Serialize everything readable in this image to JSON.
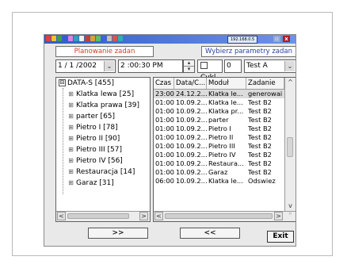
{
  "titlebar": {
    "ip_address": "192.168.0.5",
    "maximize_glyph": "▫",
    "close_glyph": "x",
    "icon_colors": [
      "#e04040",
      "#f0c030",
      "#40a040",
      "#3060d0",
      "#e080e0",
      "#30a0c0",
      "#f0f0f0",
      "#c04040",
      "#e0a030",
      "#60c060",
      "#4060e0",
      "#c0c0c0",
      "#e05050",
      "#30b0b0"
    ]
  },
  "header": {
    "left_label": "Planowanie zadan",
    "right_label": "Wybierz parametry zadan"
  },
  "controls": {
    "date_value": "1 / 1 /2002",
    "time_value": "2 :00:30 PM",
    "cycle_label": "Cykl",
    "cycle_value": "0",
    "test_select_value": "Test A",
    "dropdown_glyph": "⌄",
    "spin_up_glyph": "▴",
    "spin_down_glyph": "▾"
  },
  "tree": {
    "root_toggle": "⊟",
    "item_toggle": "⊞",
    "root": "DATA-S [455]",
    "items": [
      "Klatka lewa [25]",
      "Klatka prawa [39]",
      "parter [65]",
      "Pietro I [78]",
      "Pietro II [90]",
      "Pietro III [57]",
      "Pietro IV [56]",
      "Restauracja [14]",
      "Garaz [31]"
    ]
  },
  "grid": {
    "columns": [
      "Czas",
      "Data/C...",
      "Moduł",
      "Zadanie"
    ],
    "rows": [
      [
        "23:00",
        "24.12.2...",
        "Klatka le...",
        "generowai"
      ],
      [
        "01:00",
        "10.09.2...",
        "Klatka le...",
        "Test B2"
      ],
      [
        "01:00",
        "10.09.2...",
        "Klatka pr...",
        "Test B2"
      ],
      [
        "01:00",
        "10.09.2...",
        "parter",
        "Test B2"
      ],
      [
        "01:00",
        "10.09.2...",
        "Pietro I",
        "Test B2"
      ],
      [
        "01:00",
        "10.09.2...",
        "Pietro II",
        "Test B2"
      ],
      [
        "01:00",
        "10.09.2...",
        "Pietro III",
        "Test B2"
      ],
      [
        "01:00",
        "10.09.2...",
        "Pietro IV",
        "Test B2"
      ],
      [
        "01:00",
        "10.09.2...",
        "Restaura...",
        "Test B2"
      ],
      [
        "01:00",
        "10.09.2...",
        "Garaz",
        "Test B2"
      ],
      [
        "06:00",
        "10.09.2...",
        "Klatka le...",
        "Odswiez"
      ]
    ]
  },
  "scroll": {
    "left_glyph": "<",
    "right_glyph": ">",
    "up_glyph": "^",
    "down_glyph": "v",
    "grip_glyph": "⠿"
  },
  "buttons": {
    "next": ">>",
    "prev": "<<",
    "exit": "Exit"
  }
}
